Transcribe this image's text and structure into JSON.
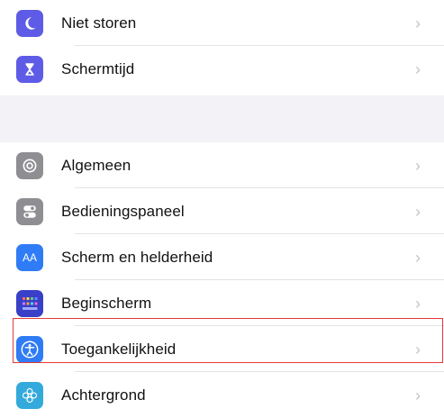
{
  "group1": [
    {
      "label": "Niet storen",
      "icon": "moon-icon",
      "color": "#5e5ce6"
    },
    {
      "label": "Schermtijd",
      "icon": "hourglass-icon",
      "color": "#5e5ce6"
    }
  ],
  "group2": [
    {
      "label": "Algemeen",
      "icon": "gear-icon",
      "color": "#8e8e93"
    },
    {
      "label": "Bedieningspaneel",
      "icon": "toggles-icon",
      "color": "#8e8e93"
    },
    {
      "label": "Scherm en helderheid",
      "icon": "text-size-icon",
      "color": "#2f7cf6",
      "glyph": "AA"
    },
    {
      "label": "Beginscherm",
      "icon": "home-grid-icon",
      "color": "#3a3fc8"
    },
    {
      "label": "Toegankelijkheid",
      "icon": "accessibility-icon",
      "color": "#2f7cf6"
    },
    {
      "label": "Achtergrond",
      "icon": "flower-icon",
      "color": "#34aadc"
    }
  ],
  "chevron": "›",
  "highlight_color": "#e53935"
}
